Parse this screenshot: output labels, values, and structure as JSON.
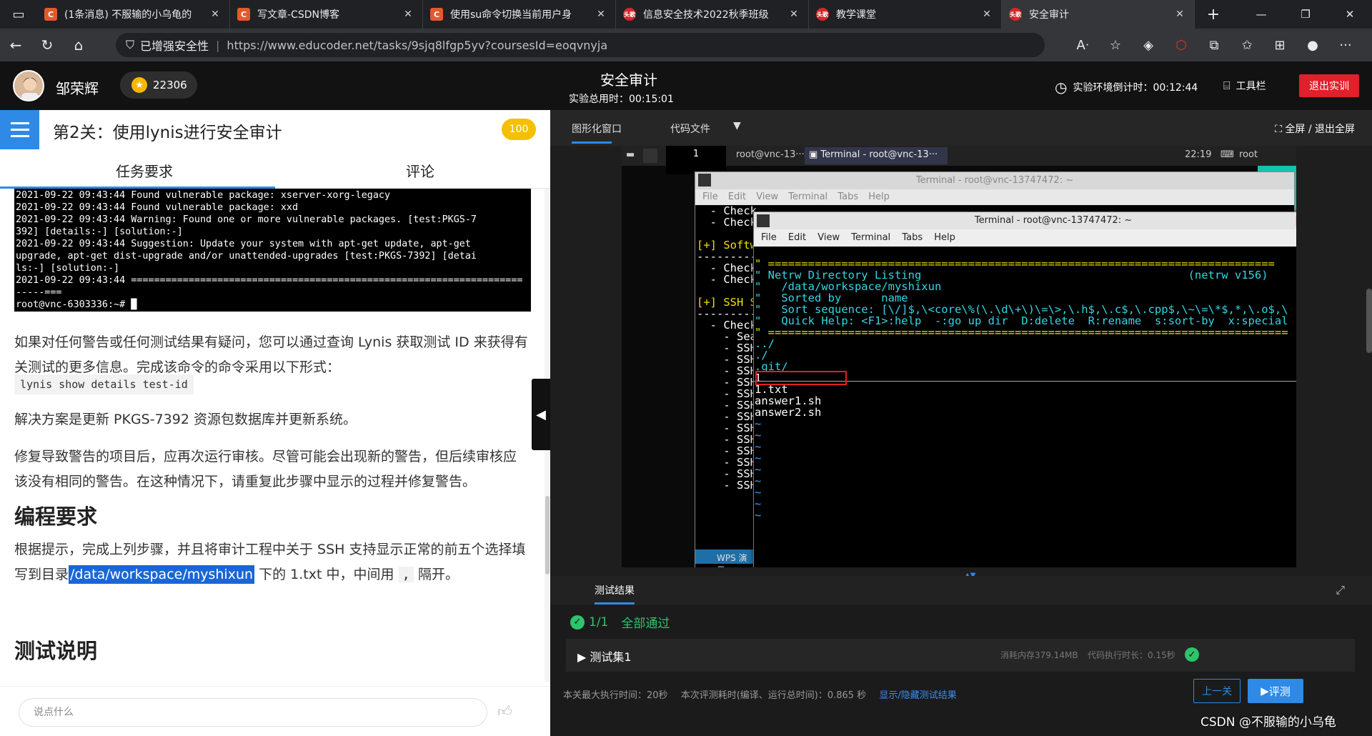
{
  "browser": {
    "tabs": [
      {
        "icon": "C",
        "title": "(1条消息) 不服输的小乌龟的"
      },
      {
        "icon": "C",
        "title": "写文章-CSDN博客"
      },
      {
        "icon": "C",
        "title": "使用su命令切换当前用户身"
      },
      {
        "icon": "头歌",
        "title": "信息安全技术2022秋季班级"
      },
      {
        "icon": "头歌",
        "title": "教学课堂"
      },
      {
        "icon": "头歌",
        "title": "安全审计"
      }
    ],
    "secure_label": "已增强安全性",
    "url": "https://www.educoder.net/tasks/9sjq8lfgp5yv?coursesId=eoqvnyja"
  },
  "header": {
    "username": "邹荣辉",
    "coins": "22306",
    "title": "安全审计",
    "total_time_label": "实验总用时：00:15:01",
    "countdown_label": "实验环境倒计时：00:12:44",
    "tools_label": "工具栏",
    "exit_label": "退出实训"
  },
  "task": {
    "title": "第2关：使用lynis进行安全审计",
    "score": "100",
    "tabs": [
      "任务要求",
      "评论"
    ],
    "terminal_lines": [
      "2021-09-22 09:43:44 Found vulnerable package: xserver-xorg-legacy",
      "2021-09-22 09:43:44 Found vulnerable package: xxd",
      "2021-09-22 09:43:44 Warning: Found one or more vulnerable packages. [test:PKGS-7",
      "392] [details:-] [solution:-]",
      "2021-09-22 09:43:44 Suggestion: Update your system with apt-get update, apt-get",
      "upgrade, apt-get dist-upgrade and/or unattended-upgrades [test:PKGS-7392] [detai",
      "ls:-] [solution:-]",
      "2021-09-22 09:43:44 ====================================================================",
      "-----===",
      "root@vnc-6303336:~# █"
    ],
    "para1": "如果对任何警告或任何测试结果有疑问，您可以通过查询 Lynis 获取测试 ID 来获得有关测试的更多信息。完成该命令的命令采用以下形式：",
    "code": "lynis show details test-id",
    "para2": "解决方案是更新 PKGS-7392 资源包数据库并更新系统。",
    "para3": "修复导致警告的项目后，应再次运行审核。尽管可能会出现新的警告，但后续审核应该没有相同的警告。在这种情况下，请重复此步骤中显示的过程并修复警告。",
    "h_programming": "编程要求",
    "para4_a": "根据提示，完成上列步骤，并且将审计工程中关于 SSH 支持显示正常的前五个选择填写到目录",
    "para4_path": "/data/workspace/myshixun",
    "para4_b": "下的 1.txt 中，中间用",
    "para4_sep": ",",
    "para4_c": "隔开。",
    "h_test": "测试说明",
    "comment_placeholder": "说点什么"
  },
  "right": {
    "tabs": [
      "图形化窗口",
      "代码文件"
    ],
    "fullscreen_label": "全屏 / 退出全屏",
    "vnc": {
      "taskbar_items": [
        "1",
        "root@vnc-13···",
        "Terminal - root@vnc-13···"
      ],
      "clock": "22:19",
      "user": "root",
      "wps_label": "WPS 演示",
      "back_term_title": "Terminal - root@vnc-13747472: ~",
      "front_term_title": "Terminal - root@vnc-13747472: ~",
      "menu": [
        "File",
        "Edit",
        "View",
        "Terminal",
        "Tabs",
        "Help"
      ],
      "back_lines": [
        "  - Check",
        "  - Check",
        "",
        "[+] Softw",
        "----------",
        "  - Check",
        "  - Check",
        "",
        "[+] SSH S",
        "----------",
        "  - Check",
        "    - Sea",
        "    - SSH",
        "    - SSH",
        "    - SSH",
        "    - SSH",
        "    - SSH",
        "    - SSH",
        "    - SSH",
        "    - SSH",
        "    - SSH",
        "    - SSH",
        "    - SSH",
        "    - SSH",
        "    - SSH"
      ],
      "netrw_header": "\" ============================================================================",
      "netrw_title": "\" Netrw Directory Listing                                        (netrw v156)",
      "netrw_dir": "\"   /data/workspace/myshixun",
      "netrw_sorted": "\"   Sorted by      name",
      "netrw_seq": "\"   Sort sequence: [\\/]$,\\<core\\%(\\.\\d\\+\\)\\=\\>,\\.h$,\\.c$,\\.cpp$,\\~\\=\\*$,*,\\.o$,\\",
      "netrw_help": "\"   Quick Help: <F1>:help  -:go up dir  D:delete  R:rename  s:sort-by  x:special",
      "netrw_footer": "\" ==============================================================================",
      "files": [
        "../",
        "./",
        ".git/",
        "1",
        "1.txt",
        "answer1.sh",
        "answer2.sh"
      ]
    }
  },
  "results": {
    "label": "测试结果",
    "pass_count": "1/1",
    "pass_text": "全部通过",
    "testset_name": "测试集1",
    "memory": "消耗内存379.14MB",
    "exec_time": "代码执行时长：0.15秒",
    "max_time": "本关最大执行时间：20秒",
    "eval_time": "本次评测耗时(编译、运行总时间)：0.865 秒",
    "toggle_link": "显示/隐藏测试结果",
    "prev_label": "上一关",
    "eval_label": "评测"
  },
  "watermark": "CSDN @不服输的小乌龟"
}
